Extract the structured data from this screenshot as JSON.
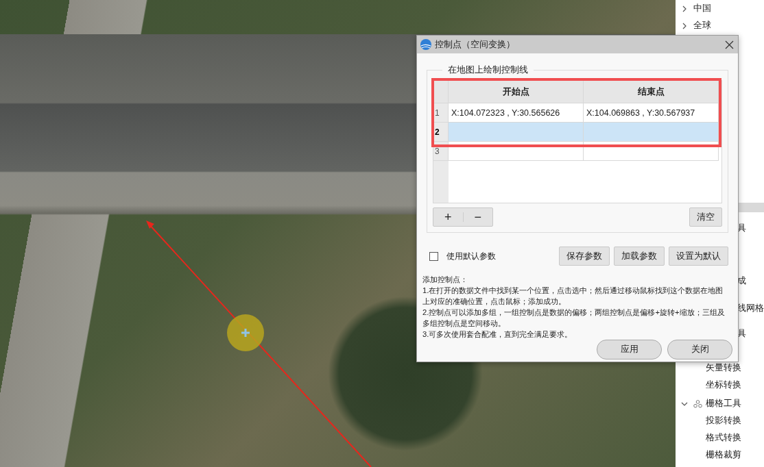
{
  "tree": [
    {
      "kind": "node",
      "label": "中国",
      "expanded": false
    },
    {
      "kind": "node",
      "label": "全球",
      "expanded": false
    },
    {
      "kind": "partial",
      "label": "具"
    },
    {
      "kind": "partial",
      "label": "成"
    },
    {
      "kind": "partial",
      "label": "线网格"
    },
    {
      "kind": "partial",
      "label": "具"
    },
    {
      "kind": "leaf",
      "label": "矢量转换"
    },
    {
      "kind": "leaf",
      "label": "坐标转换"
    },
    {
      "kind": "node",
      "label": "栅格工具",
      "expanded": true,
      "children": [
        {
          "kind": "leaf",
          "label": "投影转换"
        },
        {
          "kind": "leaf",
          "label": "格式转换"
        },
        {
          "kind": "leaf",
          "label": "栅格裁剪"
        }
      ]
    }
  ],
  "dialog": {
    "title": "控制点（空间变换）",
    "group_title": "在地图上绘制控制线",
    "table": {
      "columns": [
        "开始点",
        "结束点"
      ],
      "rows": [
        {
          "number": "1",
          "cells": [
            "X:104.072323 , Y:30.565626",
            "X:104.069863 , Y:30.567937"
          ],
          "selected": false
        },
        {
          "number": "2",
          "cells": [
            "",
            ""
          ],
          "selected": true
        },
        {
          "number": "3",
          "cells": [
            "",
            ""
          ],
          "selected": false
        }
      ]
    },
    "add_button": "+",
    "remove_button": "−",
    "clear_button": "清空",
    "default_checkbox": {
      "label": "使用默认参数",
      "checked": false
    },
    "param_buttons": [
      "保存参数",
      "加载参数",
      "设置为默认"
    ],
    "instructions": [
      "添加控制点：",
      "1.在打开的数据文件中找到某一个位置，点击选中；然后通过移动鼠标找到这个数据在地图上对应的准确位置，点击鼠标；添加成功。",
      "2.控制点可以添加多组，一组控制点是数据的偏移；两组控制点是偏移+旋转+缩放；三组及多组控制点是空间移动。",
      "3.可多次使用套合配准，直到完全满足要求。"
    ],
    "footer_buttons": [
      "应用",
      "关闭"
    ]
  }
}
